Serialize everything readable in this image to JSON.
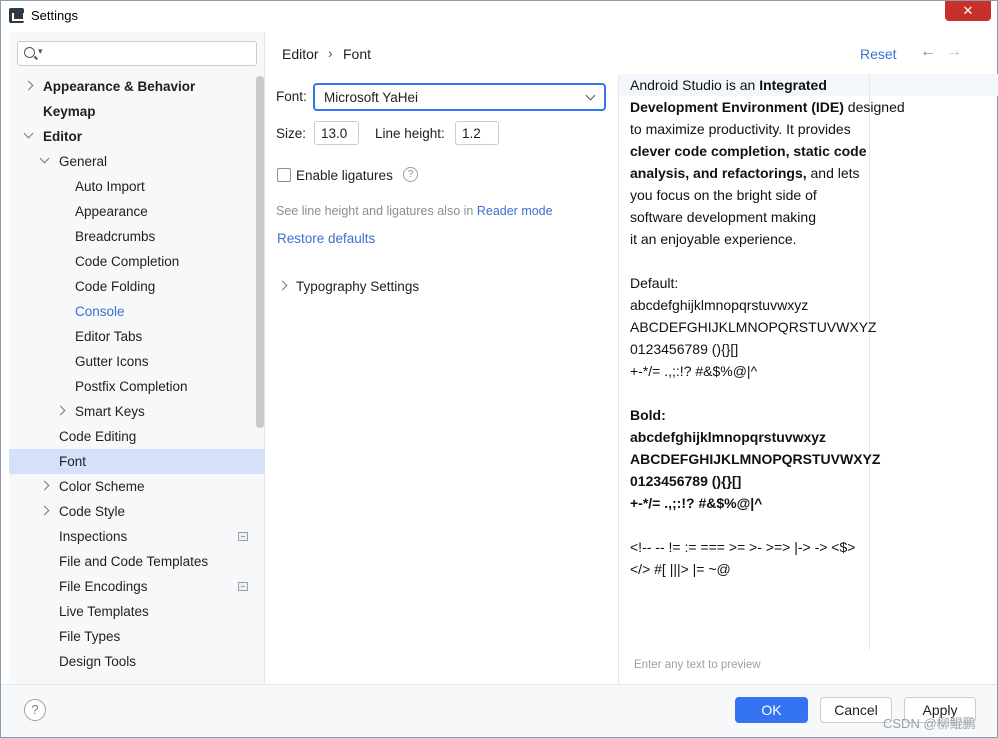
{
  "window": {
    "title": "Settings",
    "close_label": "✕"
  },
  "search": {
    "caret": "▾"
  },
  "tree": [
    {
      "label": "Appearance & Behavior",
      "bold": true,
      "chevron": "right",
      "indent": 0
    },
    {
      "label": "Keymap",
      "bold": true,
      "chevron": "",
      "indent": 0
    },
    {
      "label": "Editor",
      "bold": true,
      "chevron": "down",
      "indent": 0
    },
    {
      "label": "General",
      "chevron": "down",
      "indent": 1
    },
    {
      "label": "Auto Import",
      "chevron": "",
      "indent": 2
    },
    {
      "label": "Appearance",
      "chevron": "",
      "indent": 2
    },
    {
      "label": "Breadcrumbs",
      "chevron": "",
      "indent": 2
    },
    {
      "label": "Code Completion",
      "chevron": "",
      "indent": 2
    },
    {
      "label": "Code Folding",
      "chevron": "",
      "indent": 2
    },
    {
      "label": "Console",
      "chevron": "",
      "indent": 2,
      "link": true
    },
    {
      "label": "Editor Tabs",
      "chevron": "",
      "indent": 2
    },
    {
      "label": "Gutter Icons",
      "chevron": "",
      "indent": 2
    },
    {
      "label": "Postfix Completion",
      "chevron": "",
      "indent": 2
    },
    {
      "label": "Smart Keys",
      "chevron": "right",
      "indent": 2
    },
    {
      "label": "Code Editing",
      "chevron": "",
      "indent": 1
    },
    {
      "label": "Font",
      "chevron": "",
      "indent": 1,
      "selected": true
    },
    {
      "label": "Color Scheme",
      "chevron": "right",
      "indent": 1
    },
    {
      "label": "Code Style",
      "chevron": "right",
      "indent": 1
    },
    {
      "label": "Inspections",
      "chevron": "",
      "indent": 1,
      "badge": true
    },
    {
      "label": "File and Code Templates",
      "chevron": "",
      "indent": 1
    },
    {
      "label": "File Encodings",
      "chevron": "",
      "indent": 1,
      "badge": true
    },
    {
      "label": "Live Templates",
      "chevron": "",
      "indent": 1
    },
    {
      "label": "File Types",
      "chevron": "",
      "indent": 1
    },
    {
      "label": "Design Tools",
      "chevron": "",
      "indent": 1
    }
  ],
  "header": {
    "breadcrumb_1": "Editor",
    "breadcrumb_sep": "›",
    "breadcrumb_2": "Font",
    "reset_label": "Reset",
    "back_icon": "←",
    "forward_icon": "→"
  },
  "settings": {
    "font_label": "Font:",
    "font_value": "Microsoft YaHei",
    "size_label": "Size:",
    "size_value": "13.0",
    "line_height_label": "Line height:",
    "line_height_value": "1.2",
    "ligatures_label": "Enable ligatures",
    "ligatures_checked": false,
    "help_glyph": "?",
    "hint_text": "See line height and ligatures also in ",
    "hint_link": "Reader mode",
    "restore_label": "Restore defaults",
    "typography_label": "Typography Settings"
  },
  "preview": {
    "lines": [
      "Android Studio is an <b>Integrated</b>",
      "<b>Development Environment (IDE)</b> designed",
      "to maximize productivity. It provides",
      "<b>clever code completion, static code</b>",
      "<b>analysis, and refactorings,</b> and lets",
      "you focus on the bright side of",
      "software development making",
      "it an enjoyable experience.",
      "",
      "Default:",
      "abcdefghijklmnopqrstuvwxyz",
      "ABCDEFGHIJKLMNOPQRSTUVWXYZ",
      " 0123456789 (){}[]",
      " +-*/= .,;:!? #&$%@|^",
      "",
      "<b>Bold:</b>",
      "<b>abcdefghijklmnopqrstuvwxyz</b>",
      "<b>ABCDEFGHIJKLMNOPQRSTUVWXYZ</b>",
      "<b> 0123456789 (){}[]</b>",
      "<b> +-*/= .,;:!? #&$%@|^</b>",
      "",
      "&lt;!-- -- != := === &gt;= &gt;- &gt;=&gt; |-&gt; -&gt; &lt;$&gt;",
      "&lt;/&gt; #[ |||&gt; |= ~@"
    ],
    "hint": "Enter any text to preview"
  },
  "footer": {
    "help_glyph": "?",
    "ok_label": "OK",
    "cancel_label": "Cancel",
    "apply_label": "Apply",
    "watermark": "CSDN @柳鲲鹏"
  },
  "colors": {
    "accent": "#3574f0",
    "link": "#3c6fd0",
    "selection": "#d5e1fb"
  }
}
